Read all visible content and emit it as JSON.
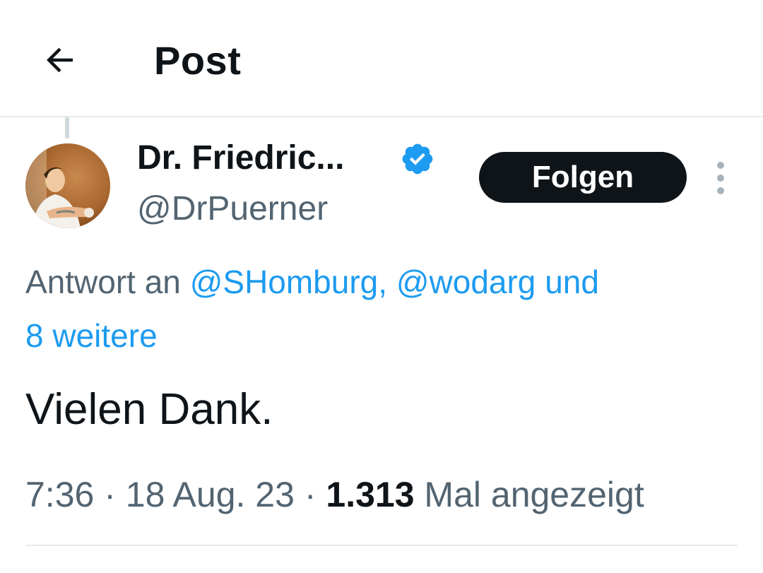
{
  "header": {
    "title": "Post",
    "back_icon": "arrow-left-icon"
  },
  "author": {
    "display_name": "Dr. Friedric...",
    "handle": "@DrPuerner",
    "verified_icon": "verified-badge-icon",
    "avatar_icon": "profile-photo",
    "follow_label": "Folgen",
    "more_icon": "more-vertical-icon"
  },
  "reply_context": {
    "prefix": "Antwort an ",
    "mention_1": "@SHomburg,",
    "mention_2": "@wodarg",
    "connector": "und",
    "more_label": "8 weitere"
  },
  "tweet": {
    "text": "Vielen Dank."
  },
  "meta": {
    "time": "7:36",
    "date": "18 Aug. 23",
    "separator": "·",
    "views_count": "1.313",
    "views_label": "Mal angezeigt"
  },
  "colors": {
    "link": "#1d9bf0",
    "secondary_text": "#536471",
    "primary_text": "#0f1419",
    "follow_button_bg": "#0f1419",
    "divider": "#e7e9ea"
  }
}
